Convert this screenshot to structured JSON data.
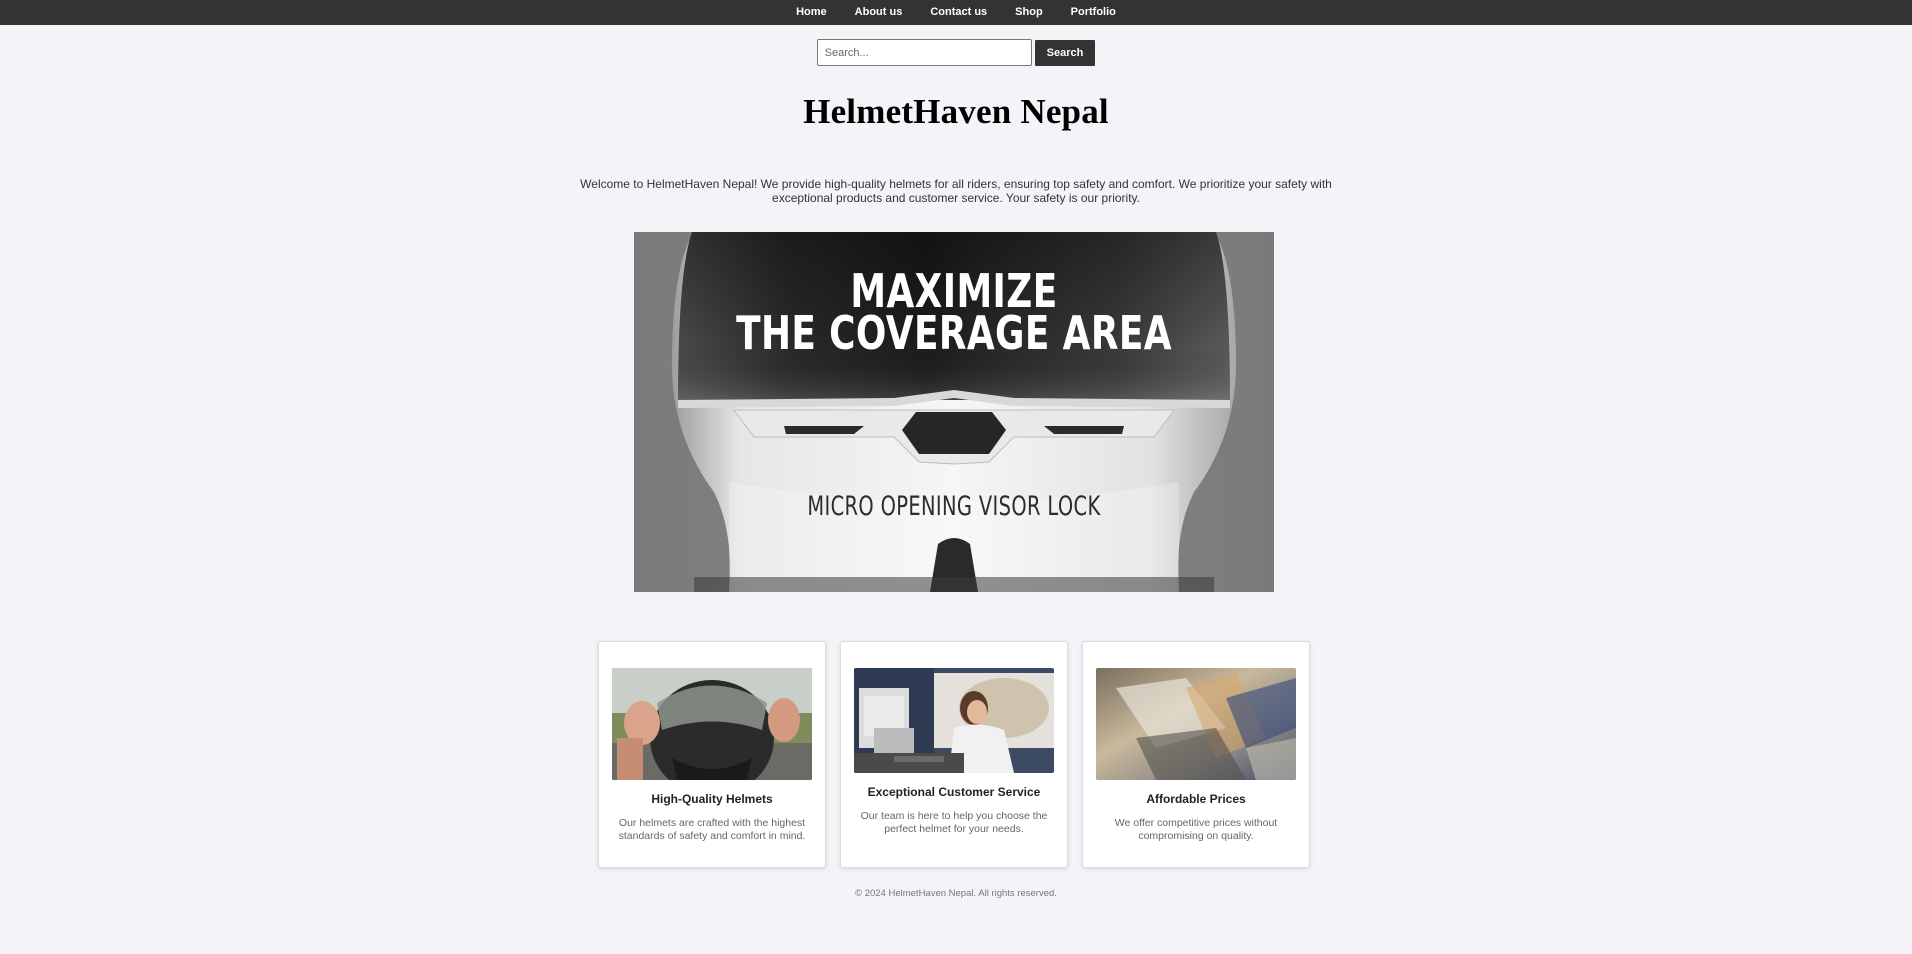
{
  "nav": {
    "items": [
      {
        "label": "Home"
      },
      {
        "label": "About us"
      },
      {
        "label": "Contact us"
      },
      {
        "label": "Shop"
      },
      {
        "label": "Portfolio"
      }
    ]
  },
  "search": {
    "placeholder": "Search...",
    "value": "",
    "button_label": "Search"
  },
  "header": {
    "title": "HelmetHaven Nepal"
  },
  "intro": {
    "text": "Welcome to HelmetHaven Nepal! We provide high-quality helmets for all riders, ensuring top safety and comfort. We prioritize your safety with exceptional products and customer service. Your safety is our priority."
  },
  "hero": {
    "line1": "MAXIMIZE",
    "line2": "THE COVERAGE AREA",
    "subline": "MICRO OPENING VISOR LOCK"
  },
  "features": [
    {
      "title": "High-Quality Helmets",
      "description": "Our helmets are crafted with the highest standards of safety and comfort in mind."
    },
    {
      "title": "Exceptional Customer Service",
      "description": "Our team is here to help you choose the perfect helmet for your needs."
    },
    {
      "title": "Affordable Prices",
      "description": "We offer competitive prices without compromising on quality."
    }
  ],
  "footer": {
    "text": "© 2024 HelmetHaven Nepal. All rights reserved."
  },
  "colors": {
    "nav_bg": "#333333",
    "page_bg": "#f4f4f8",
    "button_bg": "#333333",
    "card_bg": "#ffffff"
  }
}
